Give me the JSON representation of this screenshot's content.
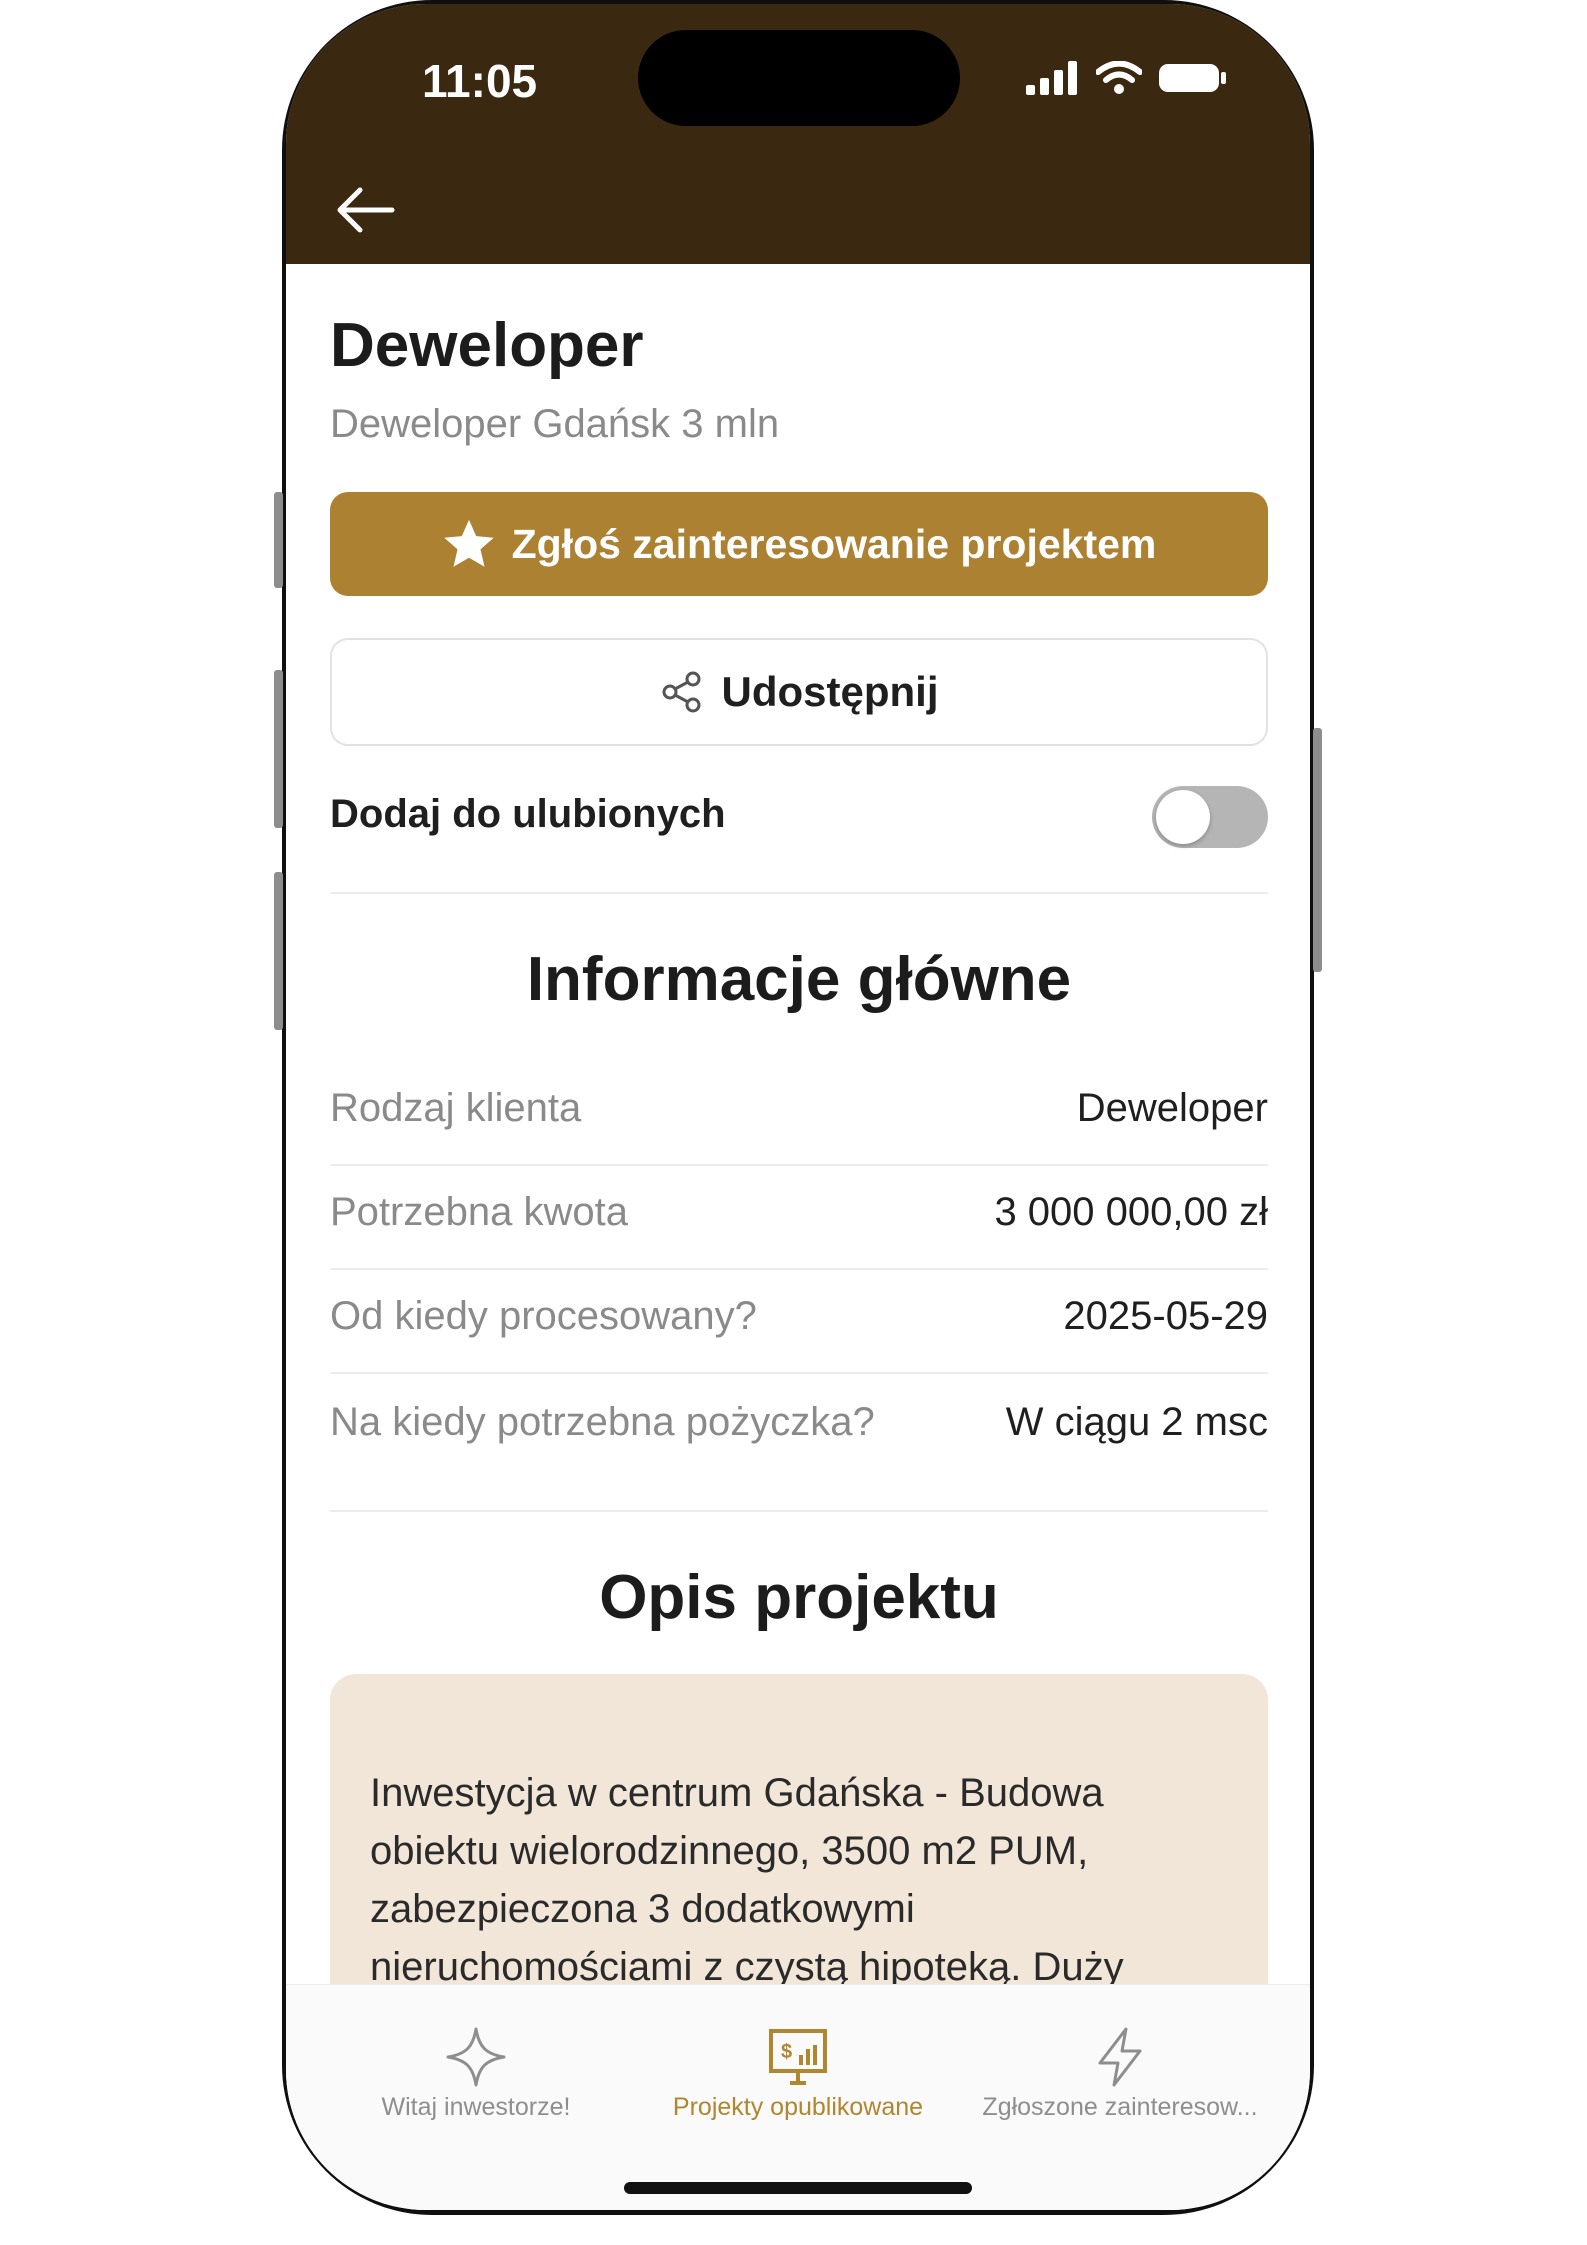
{
  "status_bar": {
    "time": "11:05"
  },
  "header": {
    "back_icon": "arrow-left-icon"
  },
  "project": {
    "title": "Deweloper",
    "subtitle": "Deweloper Gdańsk 3 mln",
    "interest_button_label": "Zgłoś zainteresowanie projektem",
    "interest_button_icon": "star-icon",
    "share_button_label": "Udostępnij",
    "share_button_icon": "share-icon",
    "favorite_label": "Dodaj do ulubionych",
    "favorite_on": false
  },
  "main_info": {
    "title": "Informacje główne",
    "rows": [
      {
        "label": "Rodzaj klienta",
        "value": "Deweloper"
      },
      {
        "label": "Potrzebna kwota",
        "value": "3 000 000,00 zł"
      },
      {
        "label": "Od kiedy procesowany?",
        "value": "2025-05-29"
      },
      {
        "label": "Na kiedy potrzebna pożyczka?",
        "value": "W ciągu 2 msc"
      }
    ]
  },
  "description": {
    "title": "Opis projektu",
    "lines": [
      "Inwestycja w centrum Gdańska - Budowa",
      "obiektu wielorodzinnego, 3500 m2 PUM,",
      "zabezpieczona 3 dodatkowymi",
      "nieruchomościami z czystą hipoteką. Duży"
    ]
  },
  "tabs": [
    {
      "label": "Witaj inwestorze!",
      "icon": "sparkle-icon",
      "active": false
    },
    {
      "label": "Projekty opublikowane",
      "icon": "presentation-chart-icon",
      "active": true
    },
    {
      "label": "Zgłoszone zainteresow...",
      "icon": "lightning-icon",
      "active": false
    }
  ],
  "colors": {
    "header_bg": "#3a2810",
    "accent": "#ac8131",
    "description_bg": "#f1e6d7",
    "tab_active": "#b0862f",
    "tab_inactive": "#8e8e8e"
  }
}
